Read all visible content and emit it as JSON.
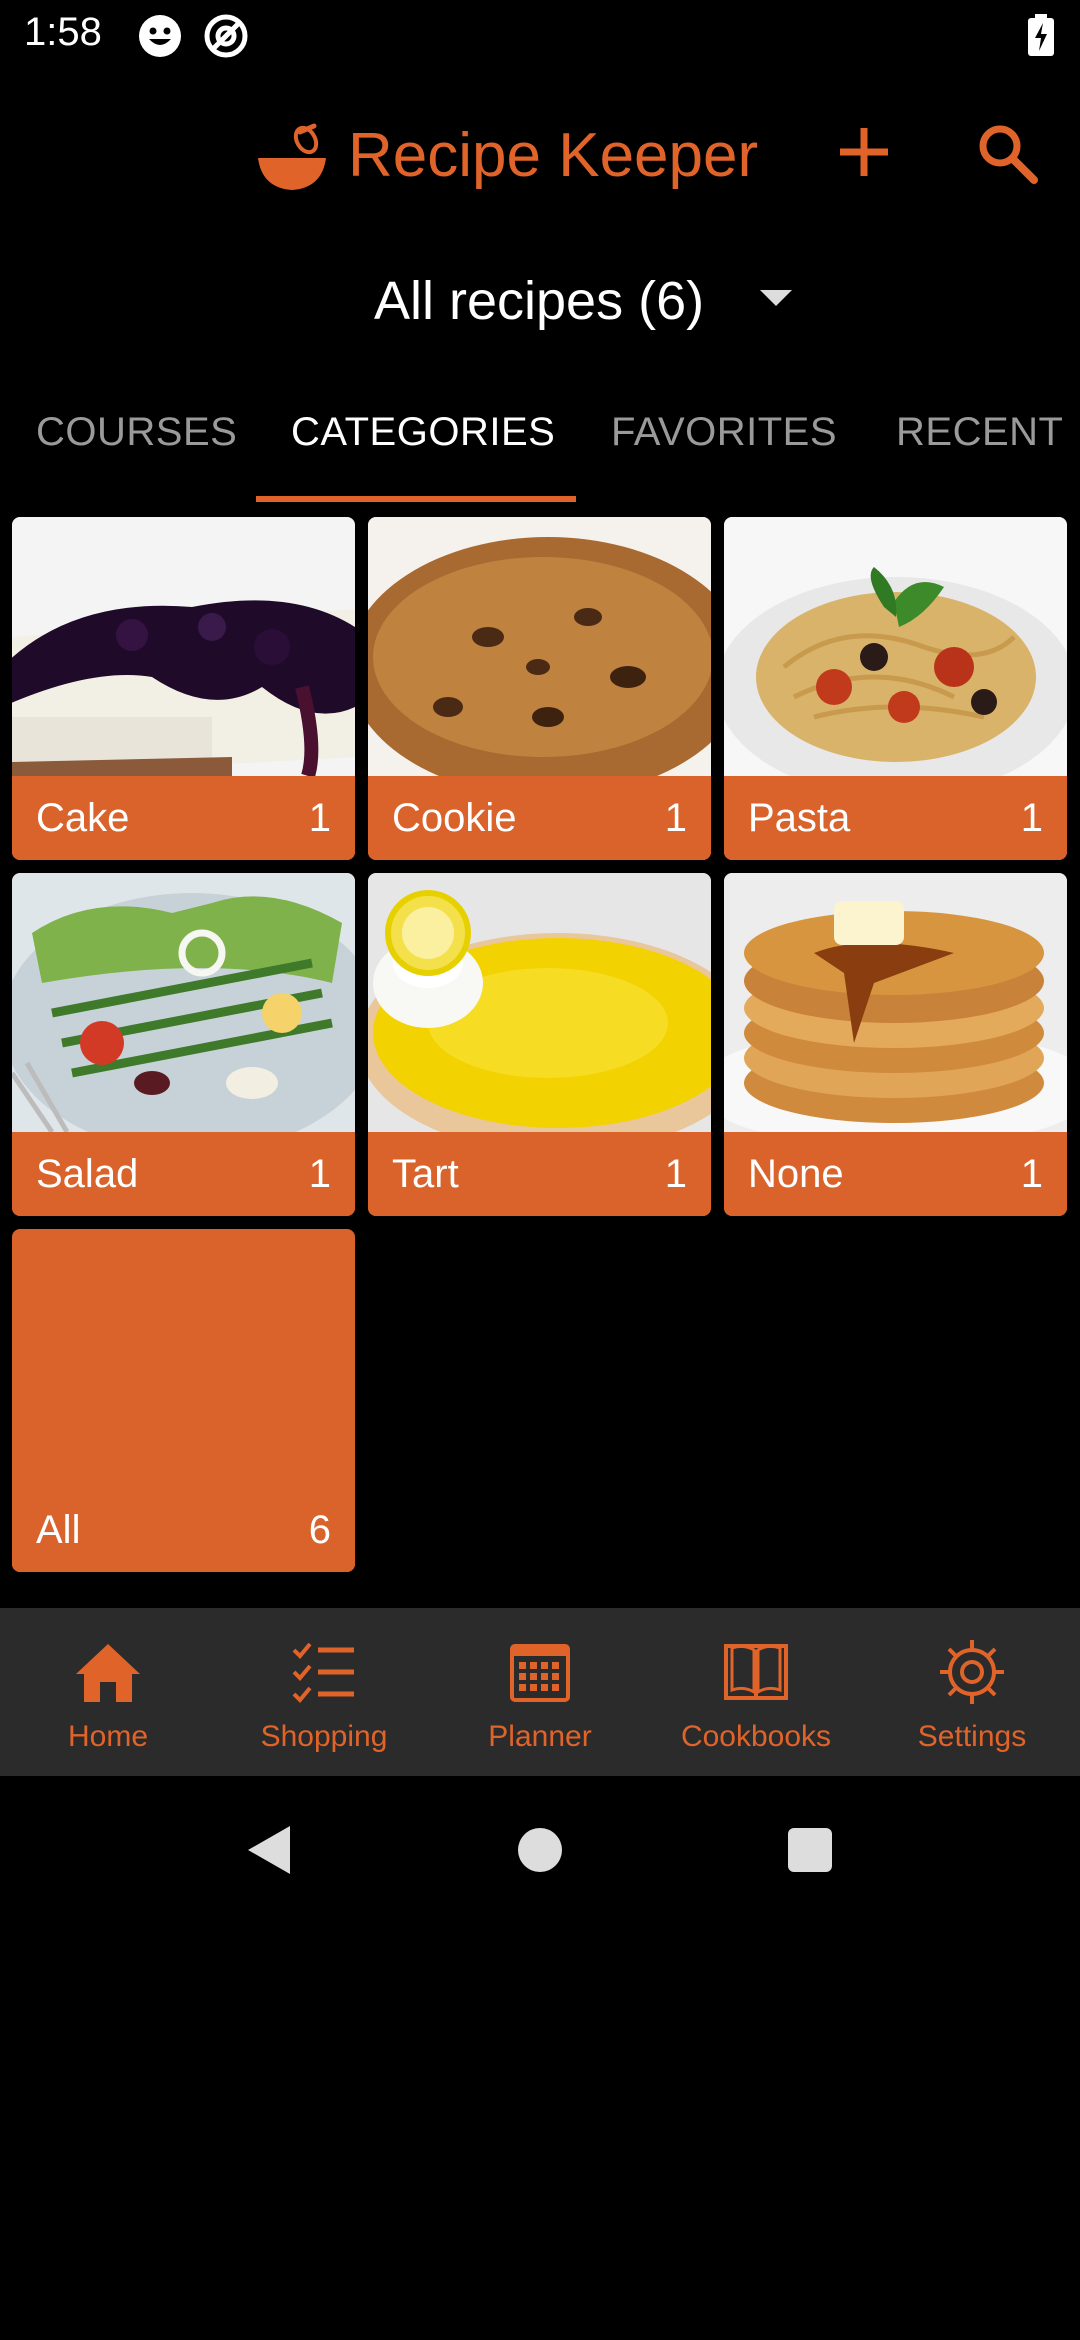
{
  "status_bar": {
    "time": "1:58"
  },
  "app_bar": {
    "title": "Recipe Keeper"
  },
  "recipes_selector": {
    "label": "All recipes (6)"
  },
  "tabs": [
    {
      "label": "COURSES",
      "active": false
    },
    {
      "label": "CATEGORIES",
      "active": true
    },
    {
      "label": "FAVORITES",
      "active": false
    },
    {
      "label": "RECENT",
      "active": false
    }
  ],
  "categories": [
    {
      "name": "Cake",
      "count": "1",
      "image": "cheesecake-photo"
    },
    {
      "name": "Cookie",
      "count": "1",
      "image": "cookies-photo"
    },
    {
      "name": "Pasta",
      "count": "1",
      "image": "spaghetti-photo"
    },
    {
      "name": "Salad",
      "count": "1",
      "image": "salad-photo"
    },
    {
      "name": "Tart",
      "count": "1",
      "image": "lemon-tart-photo"
    },
    {
      "name": "None",
      "count": "1",
      "image": "pancakes-photo"
    },
    {
      "name": "All",
      "count": "6",
      "image": ""
    }
  ],
  "bottom_nav": [
    {
      "label": "Home",
      "icon": "home-icon"
    },
    {
      "label": "Shopping",
      "icon": "checklist-icon"
    },
    {
      "label": "Planner",
      "icon": "calendar-icon"
    },
    {
      "label": "Cookbooks",
      "icon": "book-icon"
    },
    {
      "label": "Settings",
      "icon": "gear-icon"
    }
  ],
  "colors": {
    "accent": "#e0642a",
    "tile": "#d9632b",
    "nav_bg": "#2b2b2b",
    "background": "#000000"
  }
}
